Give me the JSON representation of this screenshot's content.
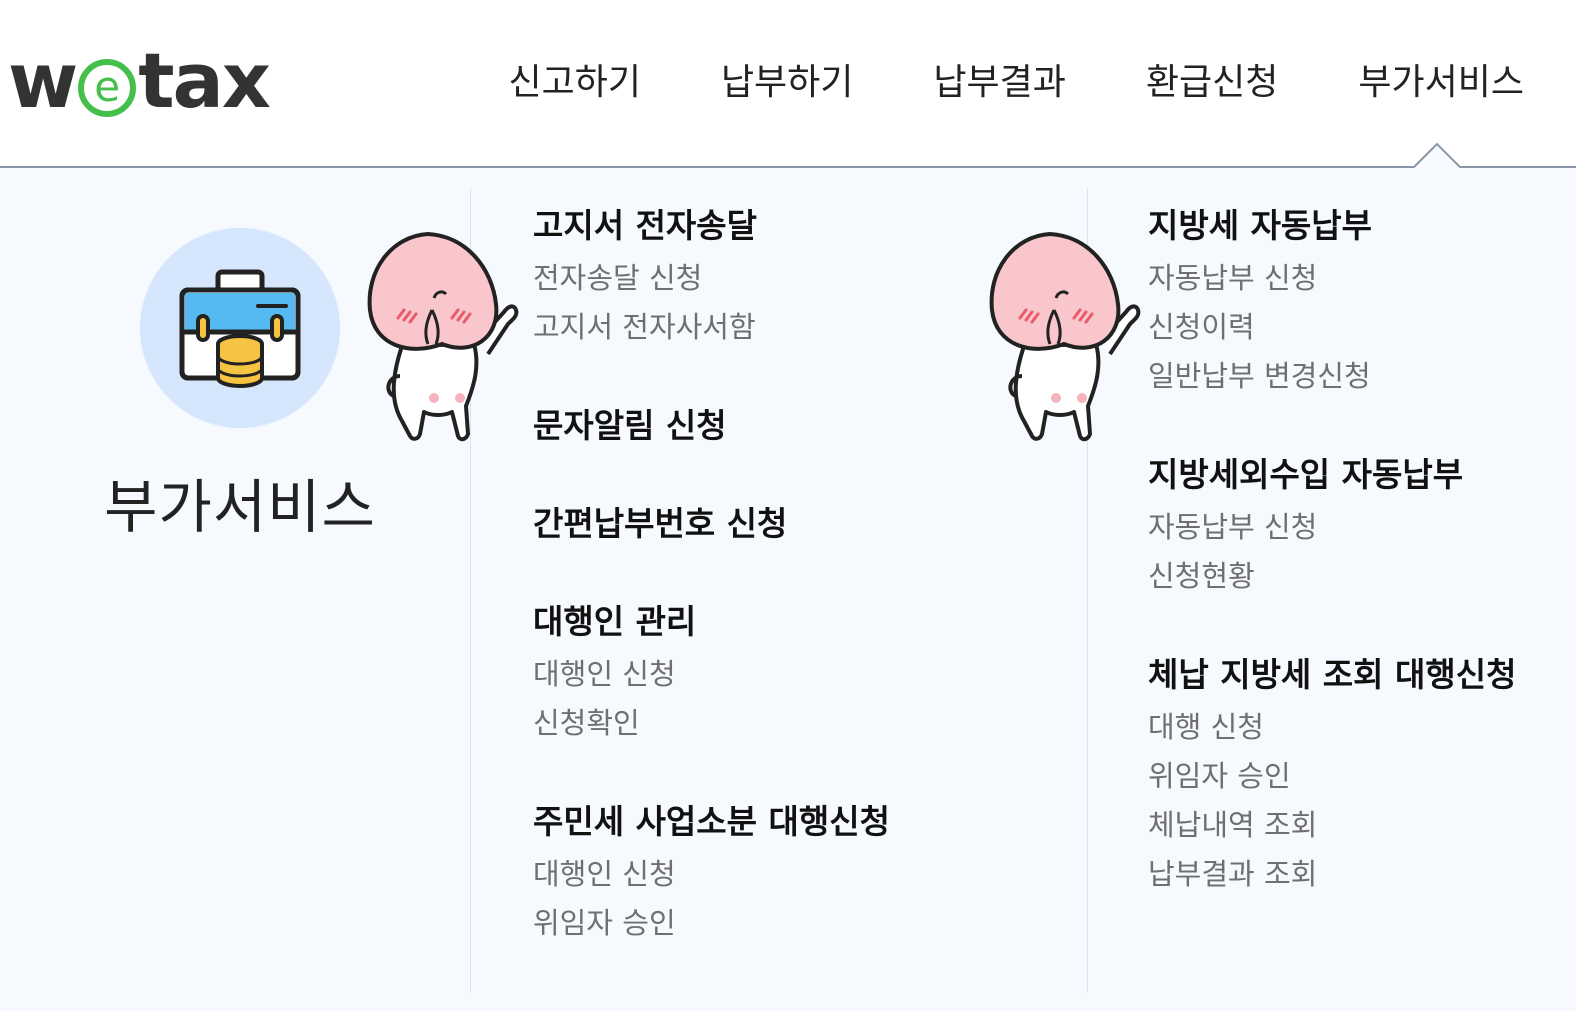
{
  "logo": {
    "w": "w",
    "e": "e",
    "rest": "tax"
  },
  "gnb": [
    "신고하기",
    "납부하기",
    "납부결과",
    "환급신청",
    "부가서비스"
  ],
  "side": {
    "title": "부가서비스",
    "icon": "toolbox-coins-icon"
  },
  "col1": {
    "g1": {
      "title": "고지서 전자송달",
      "items": [
        "전자송달 신청",
        "고지서 전자사서함"
      ]
    },
    "g2": {
      "title": "문자알림 신청"
    },
    "g3": {
      "title": "간편납부번호 신청"
    },
    "g4": {
      "title": "대행인 관리",
      "items": [
        "대행인 신청",
        "신청확인"
      ]
    },
    "g5": {
      "title": "주민세 사업소분 대행신청",
      "items": [
        "대행인 신청",
        "위임자 승인"
      ]
    }
  },
  "col2": {
    "g1": {
      "title": "지방세 자동납부",
      "items": [
        "자동납부 신청",
        "신청이력",
        "일반납부 변경신청"
      ]
    },
    "g2": {
      "title": "지방세외수입 자동납부",
      "items": [
        "자동납부 신청",
        "신청현황"
      ]
    },
    "g3": {
      "title": "체납 지방세 조회 대행신청",
      "items": [
        "대행 신청",
        "위임자 승인",
        "체납내역 조회",
        "납부결과 조회"
      ]
    }
  },
  "colors": {
    "brand_green": "#44c04a",
    "panel_bg": "#f6f9fe",
    "circle_bg": "#d6e6fd",
    "sub_text": "#6f6f6f"
  }
}
